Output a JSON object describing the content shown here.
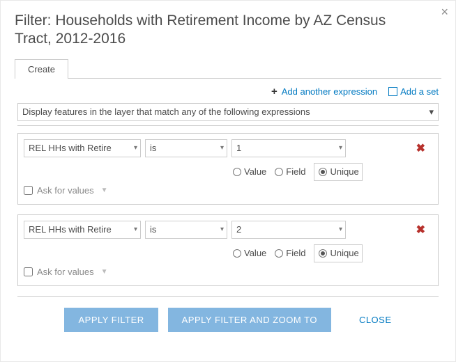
{
  "title": "Filter: Households with Retirement Income by AZ Census Tract, 2012-2016",
  "tab": {
    "create": "Create"
  },
  "toolbar": {
    "add_expression": "Add another expression",
    "add_set": "Add a set"
  },
  "match": {
    "text": "Display features in the layer that match any of the following expressions"
  },
  "labels": {
    "value": "Value",
    "field": "Field",
    "unique": "Unique",
    "ask": "Ask for values"
  },
  "expressions": [
    {
      "field": "REL HHs with Retire",
      "op": "is",
      "val": "1",
      "mode": "unique"
    },
    {
      "field": "REL HHs with Retire",
      "op": "is",
      "val": "2",
      "mode": "unique"
    }
  ],
  "footer": {
    "apply": "APPLY FILTER",
    "apply_zoom": "APPLY FILTER AND ZOOM TO",
    "close": "CLOSE"
  }
}
